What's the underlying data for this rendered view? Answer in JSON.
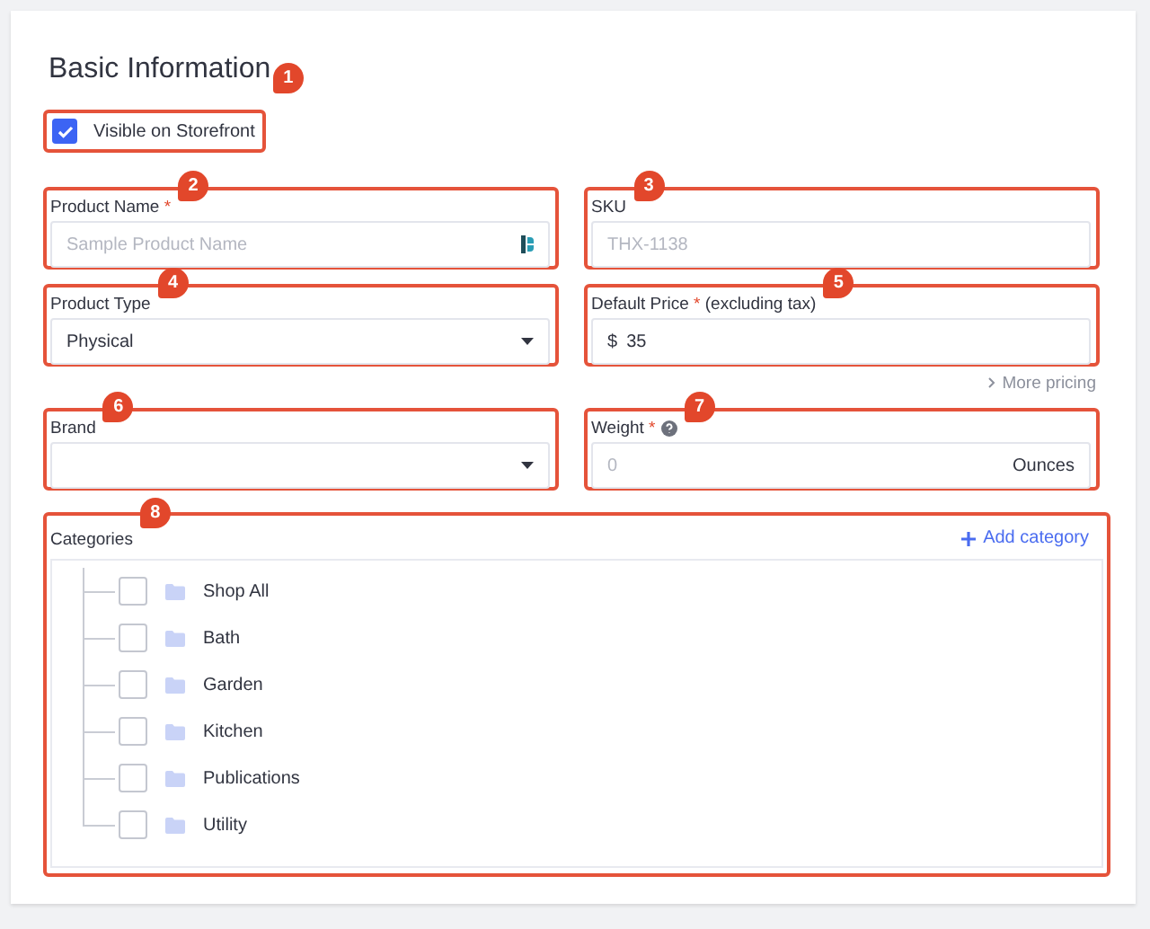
{
  "title": "Basic Information",
  "visible": {
    "label": "Visible on Storefront",
    "checked": true,
    "callout": "1"
  },
  "fields": [
    {
      "kind": "text",
      "label": "Product Name",
      "required_mark": "*",
      "placeholder": "Sample Product Name",
      "extension_icon": true,
      "callout": "2"
    },
    {
      "kind": "text",
      "label": "SKU",
      "placeholder": "THX-1138",
      "callout": "3"
    },
    {
      "kind": "select",
      "label": "Product Type",
      "value": "Physical",
      "callout": "4"
    },
    {
      "kind": "text",
      "label": "Default Price",
      "required_mark": "*",
      "note": "(excluding tax)",
      "prefix": "$",
      "value": "35",
      "link": "More pricing",
      "callout": "5"
    },
    {
      "kind": "select",
      "label": "Brand",
      "callout": "6"
    },
    {
      "kind": "text",
      "label": "Weight",
      "required_mark": "*",
      "help": true,
      "placeholder": "0",
      "suffix": "Ounces",
      "callout": "7"
    }
  ],
  "categories": {
    "label": "Categories",
    "action": "Add category",
    "callout": "8",
    "items": [
      {
        "name": "Shop All",
        "checked": false
      },
      {
        "name": "Bath",
        "checked": false
      },
      {
        "name": "Garden",
        "checked": false
      },
      {
        "name": "Kitchen",
        "checked": false
      },
      {
        "name": "Publications",
        "checked": false
      },
      {
        "name": "Utility",
        "checked": false
      }
    ]
  }
}
